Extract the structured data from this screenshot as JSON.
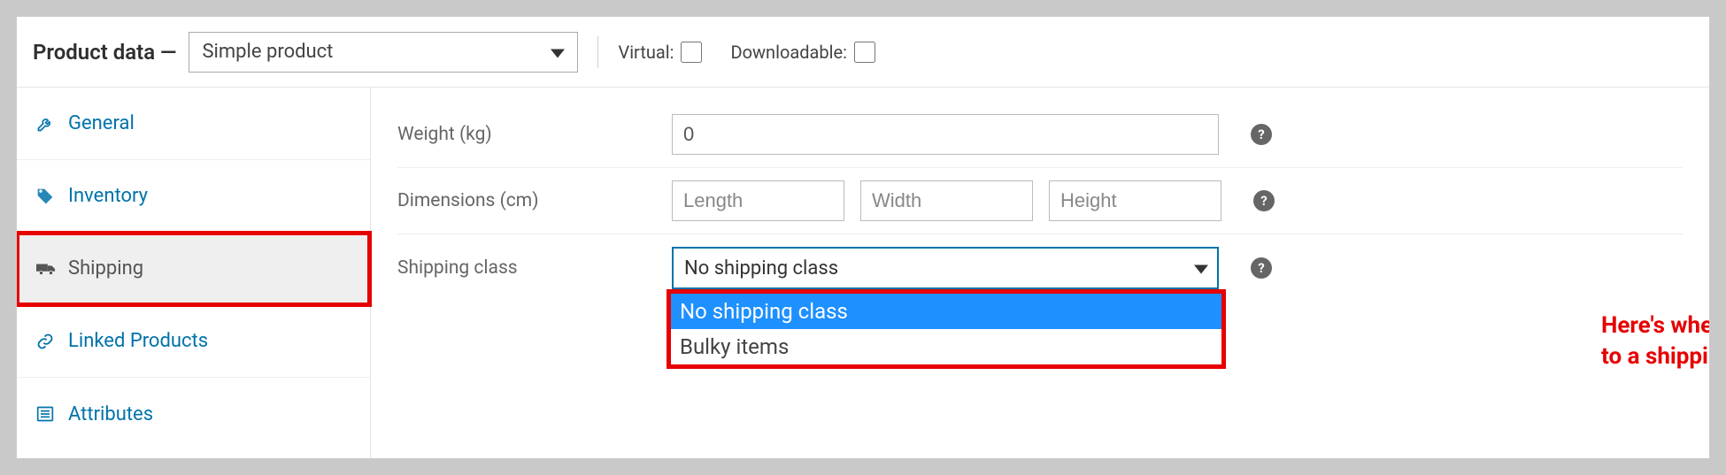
{
  "header": {
    "title": "Product data —",
    "product_type": "Simple product",
    "virtual_label": "Virtual:",
    "downloadable_label": "Downloadable:"
  },
  "sidebar": {
    "items": [
      {
        "label": "General"
      },
      {
        "label": "Inventory"
      },
      {
        "label": "Shipping"
      },
      {
        "label": "Linked Products"
      },
      {
        "label": "Attributes"
      }
    ]
  },
  "content": {
    "weight_label": "Weight (kg)",
    "weight_value": "0",
    "dimensions_label": "Dimensions (cm)",
    "length_placeholder": "Length",
    "width_placeholder": "Width",
    "height_placeholder": "Height",
    "shipping_class_label": "Shipping class",
    "shipping_class_selected": "No shipping class",
    "shipping_class_options": [
      "No shipping class",
      "Bulky items"
    ]
  },
  "annotation": "Here's where you can assign a product to a shipping class.",
  "colors": {
    "link": "#0073aa",
    "highlight": "#e60000",
    "dropdown_hover": "#1e90ff"
  }
}
